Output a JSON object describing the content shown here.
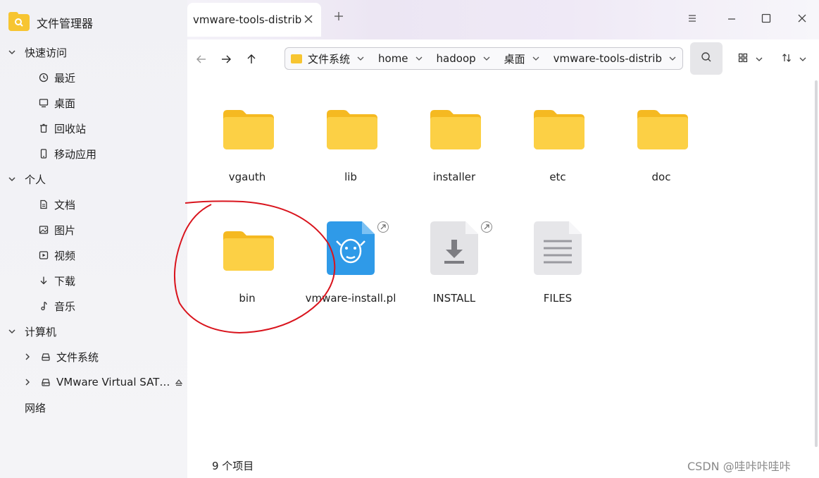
{
  "app": {
    "title": "文件管理器",
    "icon": "folder-search-icon"
  },
  "sidebar": {
    "sections": [
      {
        "label": "快速访问",
        "items": [
          {
            "label": "最近",
            "icon": "clock-icon"
          },
          {
            "label": "桌面",
            "icon": "monitor-icon"
          },
          {
            "label": "回收站",
            "icon": "trash-icon"
          },
          {
            "label": "移动应用",
            "icon": "phone-icon"
          }
        ]
      },
      {
        "label": "个人",
        "items": [
          {
            "label": "文档",
            "icon": "document-icon"
          },
          {
            "label": "图片",
            "icon": "image-icon"
          },
          {
            "label": "视频",
            "icon": "video-icon"
          },
          {
            "label": "下载",
            "icon": "download-icon"
          },
          {
            "label": "音乐",
            "icon": "music-icon"
          }
        ]
      },
      {
        "label": "计算机",
        "items": [
          {
            "label": "文件系统",
            "icon": "drive-icon"
          },
          {
            "label": "VMware Virtual SAT…",
            "icon": "disk-icon"
          }
        ]
      }
    ],
    "network_label": "网络"
  },
  "tabs": [
    {
      "label": "vmware-tools-distrib"
    }
  ],
  "breadcrumb": [
    "文件系统",
    "home",
    "hadoop",
    "桌面",
    "vmware-tools-distrib"
  ],
  "files": [
    {
      "name": "vgauth",
      "type": "folder"
    },
    {
      "name": "lib",
      "type": "folder"
    },
    {
      "name": "installer",
      "type": "folder"
    },
    {
      "name": "etc",
      "type": "folder"
    },
    {
      "name": "doc",
      "type": "folder"
    },
    {
      "name": "bin",
      "type": "folder"
    },
    {
      "name": "vmware-install.pl",
      "type": "perl-script",
      "symlink": true
    },
    {
      "name": "INSTALL",
      "type": "installer",
      "symlink": true
    },
    {
      "name": "FILES",
      "type": "text"
    }
  ],
  "status": {
    "item_count": "9 个项目"
  },
  "watermark": "CSDN @哇咔咔哇咔",
  "colors": {
    "folder": "#f7c531",
    "accent": "#2f9ae8",
    "annotation": "#d9141d"
  }
}
